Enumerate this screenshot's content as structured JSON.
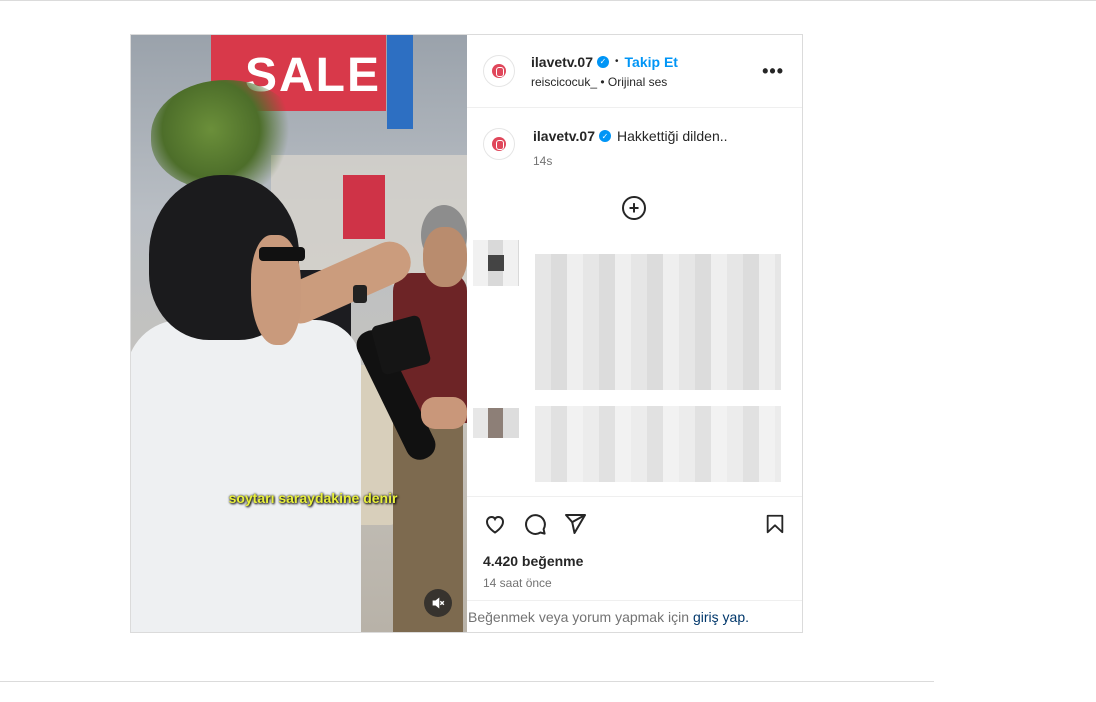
{
  "post": {
    "author": {
      "username": "ilavetv.07",
      "avatar_icon": "ilave-tv-logo",
      "verified": true,
      "follow_label": "Takip Et",
      "separator": "•"
    },
    "audio": {
      "source_user": "reiscicocuk_",
      "separator": "•",
      "label": "Orijinal ses"
    },
    "more_icon": "•••",
    "media": {
      "store_sign": "SALE",
      "subtitle": "soytarı saraydakine denir",
      "mute_icon": "muted-speaker-icon"
    },
    "caption": {
      "username": "ilavetv.07",
      "text": "Hakkettiği dilden..",
      "time": "14s"
    },
    "add_comment_icon": "+",
    "actions": {
      "like_icon": "heart-icon",
      "comment_icon": "comment-icon",
      "share_icon": "paper-plane-icon",
      "save_icon": "bookmark-icon"
    },
    "likes": "4.420 beğenme",
    "posted_ago": "14 saat önce",
    "login_prompt": {
      "text": "Beğenmek veya yorum yapmak için",
      "link": "giriş yap."
    }
  },
  "colors": {
    "link_blue": "#0095f6",
    "login_link": "#00376b",
    "subtitle_yellow": "#e9f03c",
    "border": "#dbdbdb"
  }
}
